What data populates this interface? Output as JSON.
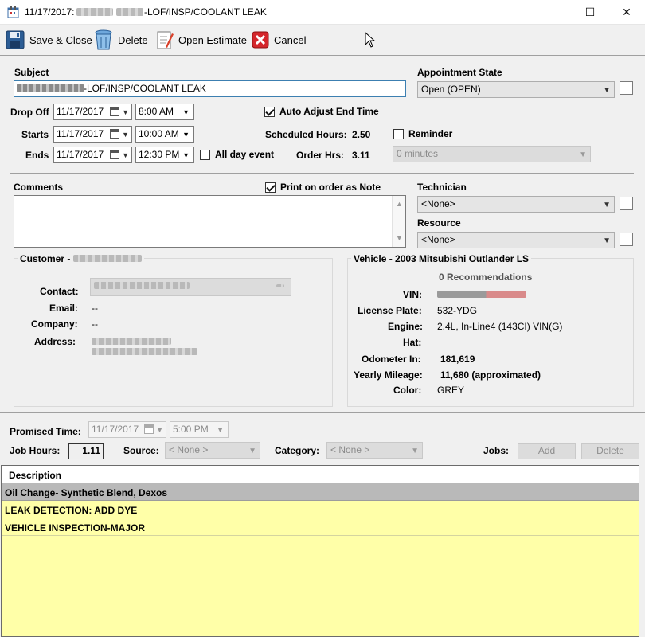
{
  "window": {
    "title_date": "11/17/2017:",
    "title_suffix": "-LOF/INSP/COOLANT LEAK",
    "minimize": "—",
    "maximize": "☐",
    "close": "✕"
  },
  "toolbar": {
    "save_close": "Save & Close",
    "delete": "Delete",
    "open_estimate": "Open Estimate",
    "cancel": "Cancel"
  },
  "form": {
    "subject_label": "Subject",
    "subject_suffix": "-LOF/INSP/COOLANT LEAK",
    "appt_state_label": "Appointment State",
    "appt_state_value": "Open (OPEN)",
    "dropoff_label": "Drop Off",
    "dropoff_date": "11/17/2017",
    "dropoff_time": "8:00 AM",
    "starts_label": "Starts",
    "starts_date": "11/17/2017",
    "starts_time": "10:00 AM",
    "ends_label": "Ends",
    "ends_date": "11/17/2017",
    "ends_time": "12:30 PM",
    "all_day_label": "All day event",
    "auto_adjust_label": "Auto Adjust End Time",
    "sched_hours_label": "Scheduled Hours:",
    "sched_hours_value": "2.50",
    "order_hrs_label": "Order Hrs:",
    "order_hrs_value": "3.11",
    "reminder_label": "Reminder",
    "reminder_value": "0 minutes",
    "comments_label": "Comments",
    "print_note_label": "Print on order as Note",
    "technician_label": "Technician",
    "technician_value": "<None>",
    "resource_label": "Resource",
    "resource_value": "<None>"
  },
  "customer": {
    "title": "Customer -",
    "contact_label": "Contact:",
    "email_label": "Email:",
    "email_value": "--",
    "company_label": "Company:",
    "company_value": "--",
    "address_label": "Address:"
  },
  "vehicle": {
    "title": "Vehicle - 2003 Mitsubishi Outlander LS",
    "recommendations": "0 Recommendations",
    "vin_label": "VIN:",
    "plate_label": "License Plate:",
    "plate_value": "532-YDG",
    "engine_label": "Engine:",
    "engine_value": "2.4L, In-Line4 (143CI) VIN(G)",
    "hat_label": "Hat:",
    "odometer_label": "Odometer In:",
    "odometer_value": "181,619",
    "mileage_label": "Yearly Mileage:",
    "mileage_value": "11,680 (approximated)",
    "color_label": "Color:",
    "color_value": "GREY"
  },
  "jobs": {
    "promised_label": "Promised Time:",
    "promised_date": "11/17/2017",
    "promised_time": "5:00 PM",
    "job_hours_label": "Job Hours:",
    "job_hours_value": "1.11",
    "source_label": "Source:",
    "source_value": "< None >",
    "category_label": "Category:",
    "category_value": "< None >",
    "jobs_label": "Jobs:",
    "add_label": "Add",
    "delete_label": "Delete",
    "grid_header": "Description",
    "rows": [
      "Oil Change- Synthetic Blend, Dexos",
      "LEAK DETECTION: ADD DYE",
      "VEHICLE INSPECTION-MAJOR"
    ]
  }
}
